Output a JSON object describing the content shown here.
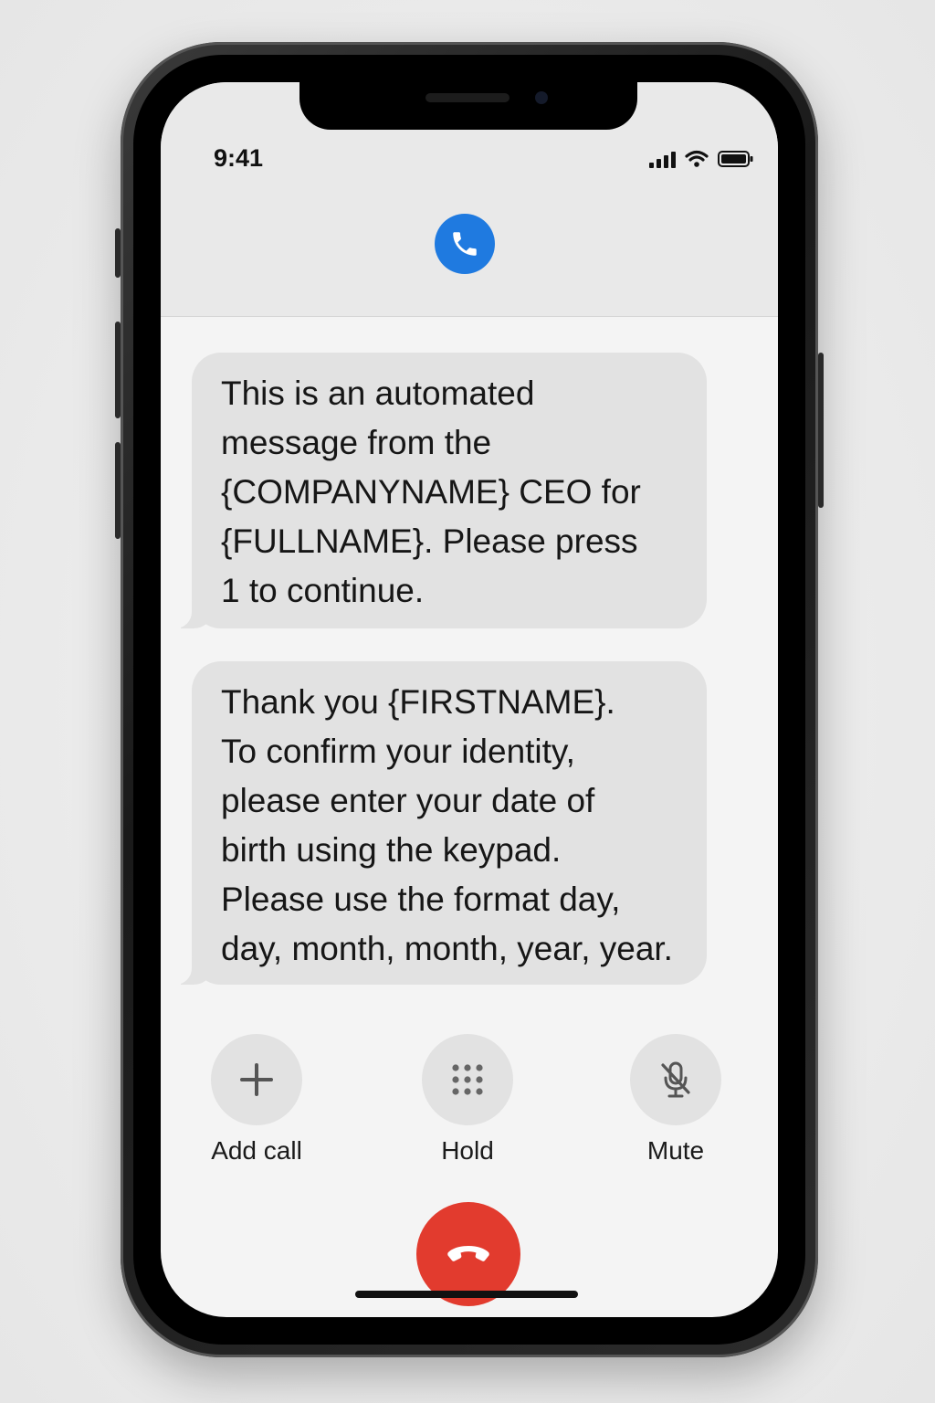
{
  "status_bar": {
    "time": "9:41",
    "signal_icon": "cellular-signal-icon",
    "wifi_icon": "wifi-icon",
    "battery_icon": "battery-icon"
  },
  "call_header": {
    "icon": "phone-icon",
    "accent_color": "#1f7ae0"
  },
  "messages": [
    {
      "lines": [
        "This is an automated",
        "message from the",
        "{COMPANYNAME} CEO for",
        "{FULLNAME}. Please press",
        "1 to continue."
      ]
    },
    {
      "lines": [
        "Thank you {FIRSTNAME}.",
        "To confirm your identity,",
        "please enter your date of",
        "birth using the keypad.",
        "Please use the format day,",
        "day, month, month, year, year."
      ]
    }
  ],
  "controls": {
    "add_call": {
      "label": "Add call",
      "icon": "plus-icon"
    },
    "hold": {
      "label": "Hold",
      "icon": "keypad-icon"
    },
    "mute": {
      "label": "Mute",
      "icon": "microphone-off-icon"
    }
  },
  "end_call": {
    "icon": "hang-up-icon",
    "color": "#e23b2e"
  }
}
